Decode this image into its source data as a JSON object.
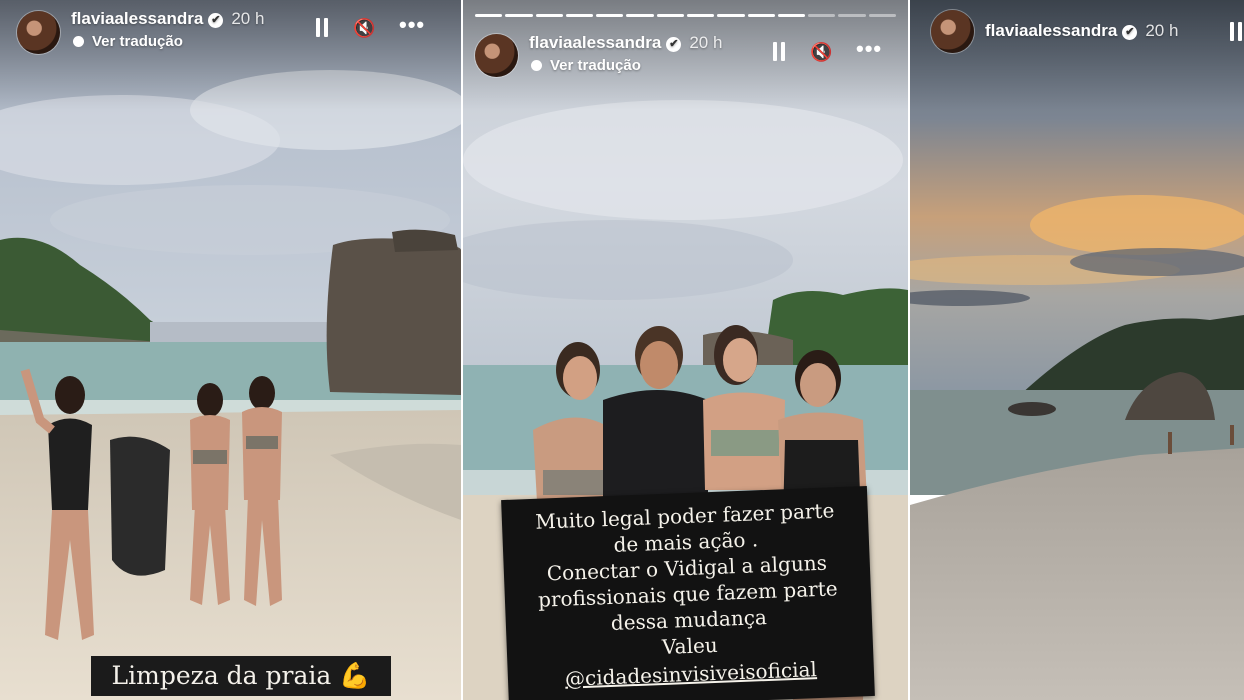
{
  "stories": [
    {
      "username": "flaviaalessandra",
      "verified_glyph": "✔",
      "time": "20 h",
      "translate_label": "Ver tradução",
      "caption": "Limpeza da praia",
      "caption_icon": "flexed-biceps-icon"
    },
    {
      "username": "flaviaalessandra",
      "verified_glyph": "✔",
      "time": "20 h",
      "translate_label": "Ver tradução",
      "progress_segments_total": 14,
      "progress_segments_watched": 11,
      "sign_lines": [
        "Muito legal poder fazer parte",
        "de mais ação .",
        "Conectar o Vidigal a alguns",
        "profissionais que fazem parte",
        "dessa mudança",
        "Valeu"
      ],
      "sign_mention": "@cidadesinvisiveisoficial"
    },
    {
      "username": "flaviaalessandra",
      "verified_glyph": "✔",
      "time": "20 h"
    }
  ],
  "controls": {
    "pause_icon": "pause-icon",
    "mute_icon": "speaker-muted-icon",
    "mute_glyph": "🔇",
    "more_icon": "more-dots-icon",
    "more_glyph": "•••"
  },
  "colors": {
    "sky_overcast": "#b7bfcc",
    "sea": "#8fb2b0",
    "sand": "#e0d6c6",
    "sunset": "#f0b66a",
    "caption_bg": "#1b1b1b"
  }
}
